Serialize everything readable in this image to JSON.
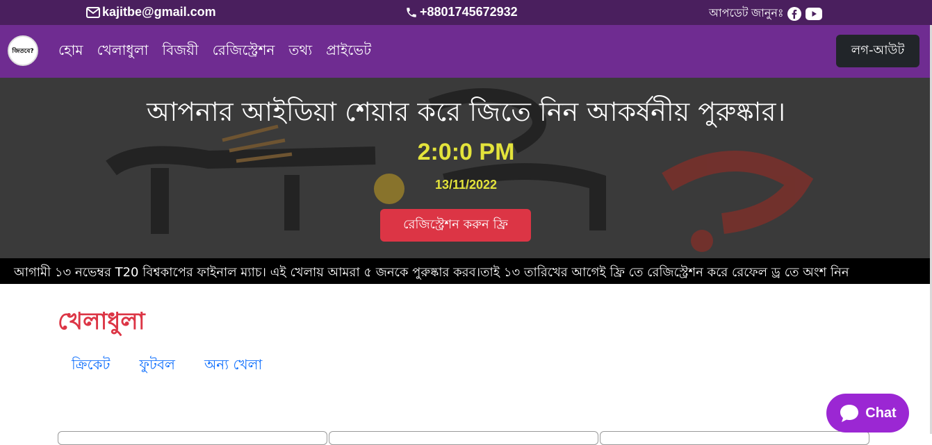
{
  "topbar": {
    "email": "kajitbe@gmail.com",
    "phone": "+8801745672932",
    "updates_label": "আপডেট জানুনঃ",
    "social_icons": [
      "facebook-icon",
      "youtube-icon"
    ]
  },
  "navbar": {
    "logo_text": "জিতবে?",
    "items": [
      {
        "label": "হোম"
      },
      {
        "label": "খেলাধুলা"
      },
      {
        "label": "বিজয়ী"
      },
      {
        "label": "রেজিস্ট্রেশন"
      },
      {
        "label": "তথ্য"
      },
      {
        "label": "প্রাইভেট"
      }
    ],
    "logout_label": "লগ-আউট"
  },
  "hero": {
    "title": "আপনার আইডিয়া শেয়ার করে জিতে নিন আকর্ষনীয় পুরুষ্কার।",
    "time": "2:0:0 PM",
    "date": "13/11/2022",
    "register_label": "রেজিস্ট্রেশন করুন ফ্রি"
  },
  "marquee": {
    "text": "আগামী ১৩ নভেম্বর T20 বিশ্বকাপের ফাইনাল ম্যাচ। এই খেলায় আমরা ৫ জনকে পুরুষ্কার করব।তাই ১৩ তারিখের আগেই ফ্রি তে রেজিস্ট্রেশন করে রেফেল ড্র তে অংশ নিন"
  },
  "main": {
    "section_title": "খেলাধুলা",
    "tabs": [
      {
        "label": "ক্রিকেট"
      },
      {
        "label": "ফুটবল"
      },
      {
        "label": "অন্য খেলা"
      }
    ]
  },
  "chat": {
    "label": "Chat"
  },
  "colors": {
    "topbar": "#4a1f5e",
    "navbar": "#6f2c91",
    "accent_red": "#dc3545",
    "time_yellow": "#e3e33b",
    "link_blue": "#0d6efd",
    "chat_purple": "#9b27d3"
  }
}
